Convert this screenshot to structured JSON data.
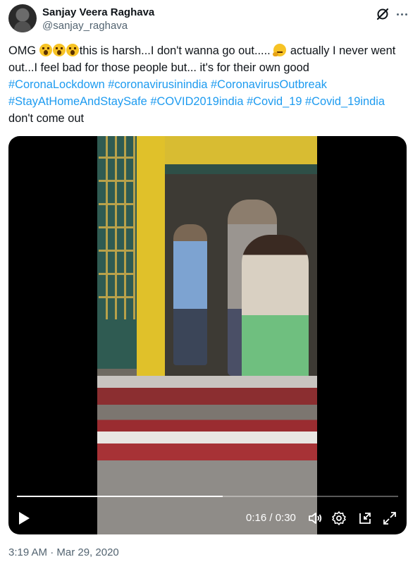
{
  "author": {
    "name": "Sanjay Veera Raghava",
    "handle": "@sanjay_raghava"
  },
  "header_icons": [
    "grok-icon",
    "more-icon"
  ],
  "tweet": {
    "text_1": "OMG ",
    "emoji_scream": "😱",
    "text_2": "this is harsh...I don't wanna go out..... ",
    "emoji_think": "🤔",
    "text_3": " actually I never went out...I feel bad for those people but... it's for their own good",
    "hashtags": [
      "#CoronaLockdown",
      "#coronavirusinindia",
      "#CoronavirusOutbreak",
      "#StayAtHomeAndStaySafe",
      "#COVID2019india",
      "#Covid_19",
      "#Covid_19india"
    ],
    "text_end": "don't come out"
  },
  "video": {
    "current_time": "0:16",
    "total_time": "0:30",
    "time_display": "0:16 / 0:30",
    "progress": 0.54,
    "controls": [
      "play-icon",
      "volume-icon",
      "settings-icon",
      "picture-in-picture-icon",
      "fullscreen-icon"
    ]
  },
  "timestamp": "3:19 AM · Mar 29, 2020",
  "colors": {
    "text": "#0f1419",
    "secondary": "#536471",
    "link": "#1d9bf0",
    "video_bg": "#000000"
  }
}
